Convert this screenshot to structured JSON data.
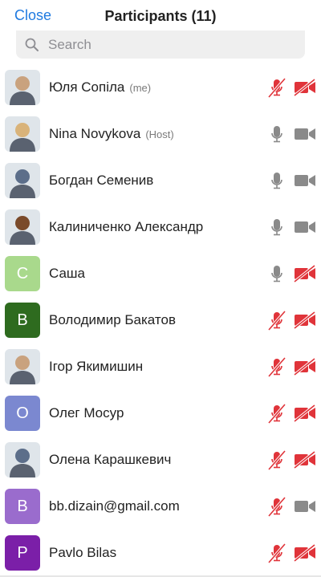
{
  "header": {
    "close_label": "Close",
    "title": "Participants (11)"
  },
  "search": {
    "placeholder": "Search"
  },
  "colors": {
    "accent": "#1f7ae0",
    "muted_red": "#e0343a",
    "active_gray": "#8a8a8a"
  },
  "participants": [
    {
      "name": "Юля Сопіла",
      "tag": "(me)",
      "avatar_type": "photo",
      "avatar_icon": "avatar-photo",
      "mic": "muted",
      "video": "off"
    },
    {
      "name": "Nina Novykova",
      "tag": "(Host)",
      "avatar_type": "photo",
      "avatar_icon": "avatar-photo",
      "mic": "on",
      "video": "on"
    },
    {
      "name": "Богдан Семенив",
      "tag": "",
      "avatar_type": "photo",
      "avatar_icon": "avatar-photo",
      "mic": "on",
      "video": "on"
    },
    {
      "name": "Калиниченко Александр",
      "tag": "",
      "avatar_type": "photo",
      "avatar_icon": "avatar-photo",
      "mic": "on",
      "video": "on"
    },
    {
      "name": "Саша",
      "tag": "",
      "avatar_type": "letter",
      "letter": "C",
      "avatar_color": "#a9d98c",
      "mic": "on",
      "video": "off"
    },
    {
      "name": "Володимир Бакатов",
      "tag": "",
      "avatar_type": "letter",
      "letter": "B",
      "avatar_color": "#2e6b1f",
      "mic": "muted",
      "video": "off"
    },
    {
      "name": "Ігор Якимишин",
      "tag": "",
      "avatar_type": "photo",
      "avatar_icon": "avatar-photo",
      "mic": "muted",
      "video": "off"
    },
    {
      "name": "Олег Мосур",
      "tag": "",
      "avatar_type": "letter",
      "letter": "O",
      "avatar_color": "#7b88d0",
      "mic": "muted",
      "video": "off"
    },
    {
      "name": "Олена Карашкевич",
      "tag": "",
      "avatar_type": "photo",
      "avatar_icon": "avatar-photo",
      "mic": "muted",
      "video": "off"
    },
    {
      "name": "bb.dizain@gmail.com",
      "tag": "",
      "avatar_type": "letter",
      "letter": "B",
      "avatar_color": "#9a6ccd",
      "mic": "muted",
      "video": "on"
    },
    {
      "name": "Pavlo Bilas",
      "tag": "",
      "avatar_type": "letter",
      "letter": "P",
      "avatar_color": "#7b1fa8",
      "mic": "muted",
      "video": "off"
    }
  ]
}
